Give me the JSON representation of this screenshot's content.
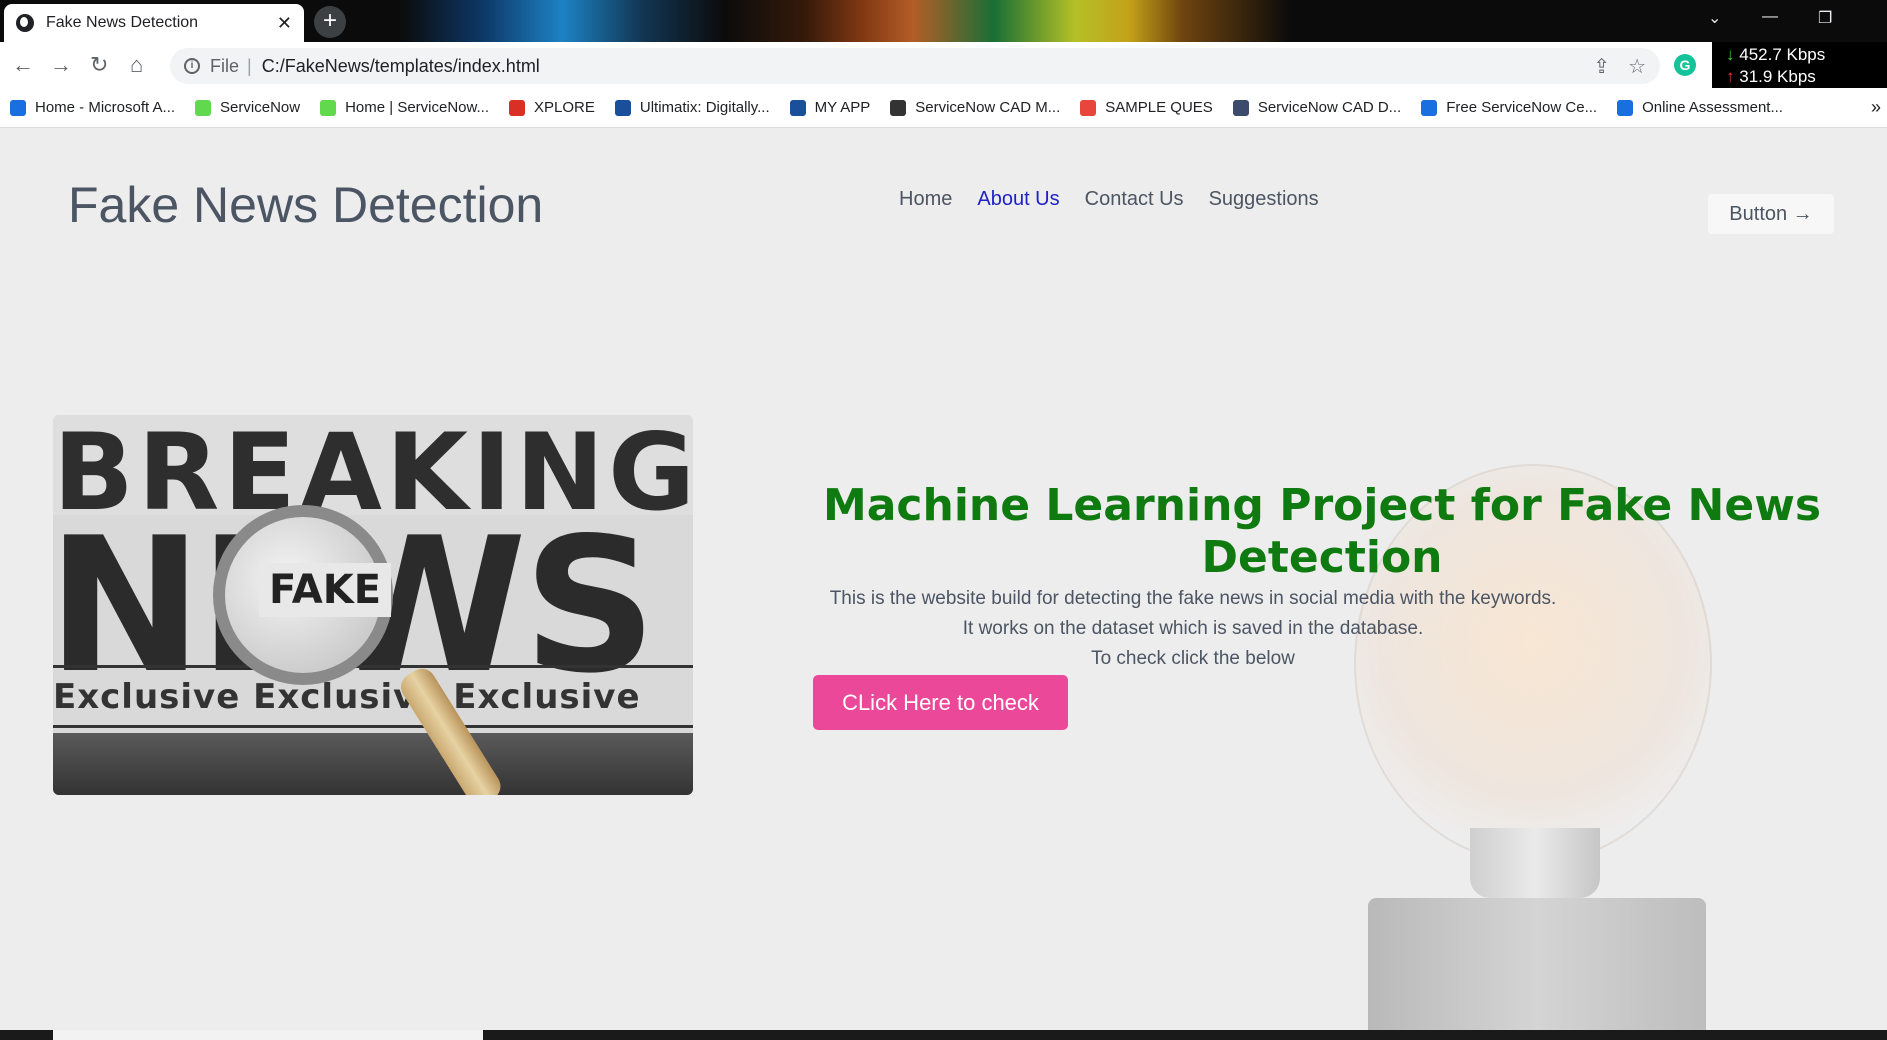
{
  "browser": {
    "tab_title": "Fake News Detection",
    "tab_close": "✕",
    "new_tab": "+",
    "window_controls": [
      "⌄",
      "—",
      "❐"
    ],
    "url_scheme": "File",
    "url_separator": "|",
    "url": "C:/FakeNews/templates/index.html",
    "info_icon": "i",
    "extension_initial": "G",
    "net_speed": {
      "down": "452.7 Kbps",
      "up": "31.9 Kbps"
    },
    "bookmarks": [
      {
        "label": "Home - Microsoft A...",
        "color": "#1a6fe0"
      },
      {
        "label": "ServiceNow",
        "color": "#62d84e"
      },
      {
        "label": "Home | ServiceNow...",
        "color": "#62d84e"
      },
      {
        "label": "XPLORE",
        "color": "#d93025"
      },
      {
        "label": "Ultimatix: Digitally...",
        "color": "#1a4f9c"
      },
      {
        "label": "MY APP",
        "color": "#1a4f9c"
      },
      {
        "label": "ServiceNow CAD M...",
        "color": "#333333"
      },
      {
        "label": "SAMPLE QUES",
        "color": "#e8453c"
      },
      {
        "label": "ServiceNow CAD D...",
        "color": "#3c4a6b"
      },
      {
        "label": "Free ServiceNow Ce...",
        "color": "#1a6fe0"
      },
      {
        "label": "Online Assessment...",
        "color": "#1a6fe0"
      }
    ],
    "bookmarks_overflow": "»"
  },
  "site": {
    "brand": "Fake News Detection",
    "nav": [
      {
        "label": "Home",
        "active": false
      },
      {
        "label": "About Us",
        "active": true
      },
      {
        "label": "Contact Us",
        "active": false
      },
      {
        "label": "Suggestions",
        "active": false
      }
    ],
    "header_button": "Button →",
    "hero_image_text": {
      "line1": "BREAKING",
      "line2": "NEWS",
      "lens": "FAKE",
      "line3": "Exclusive Exclusive Exclusive"
    },
    "headline": "Machine Learning Project for Fake News Detection",
    "description": [
      "This is the website build for detecting the fake news in social media with the keywords.",
      "It works on the dataset which is saved in the database.",
      "To check click the below"
    ],
    "cta": "CLick Here to check"
  },
  "colors": {
    "headline_green": "#0f7a0f",
    "cta_pink": "#ec4899",
    "active_nav": "#1e22c8",
    "page_bg": "#eeeded"
  }
}
